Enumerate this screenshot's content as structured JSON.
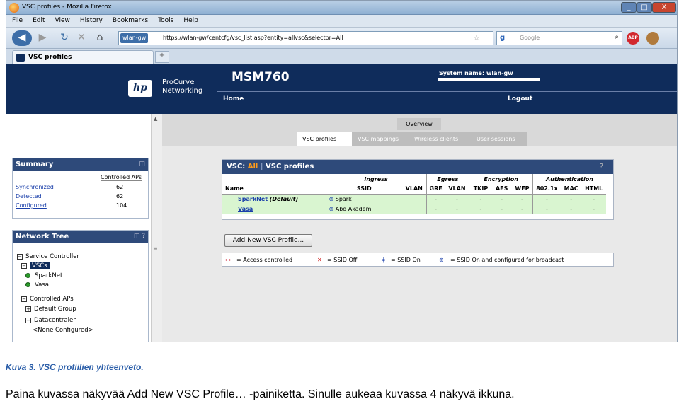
{
  "window": {
    "title": "VSC profiles - Mozilla Firefox",
    "min": "_",
    "max": "□",
    "close": "X"
  },
  "menu": [
    "File",
    "Edit",
    "View",
    "History",
    "Bookmarks",
    "Tools",
    "Help"
  ],
  "nav": {
    "site_label": "wlan-gw",
    "url": "https://wlan-gw/centcfg/vsc_list.asp?entity=allvsc&selector=All",
    "search_placeholder": "Google"
  },
  "tab": {
    "label": "VSC profiles",
    "new_tab": "+"
  },
  "header": {
    "brand_line1": "ProCurve",
    "brand_line2": "Networking",
    "product": "MSM760",
    "system_name_label": "System name: wlan-gw",
    "home": "Home",
    "logout": "Logout",
    "logo": "hp"
  },
  "subtabs": {
    "overview": "Overview",
    "items": [
      "VSC profiles",
      "VSC mappings",
      "Wireless clients",
      "User sessions"
    ]
  },
  "summary": {
    "title": "Summary",
    "col_header": "Controlled APs",
    "rows": [
      {
        "label": "Synchronized",
        "value": "62"
      },
      {
        "label": "Detected",
        "value": "62"
      },
      {
        "label": "Configured",
        "value": "104"
      }
    ]
  },
  "network_tree": {
    "title": "Network Tree",
    "service_controller": "Service Controller",
    "vscs": "VSCs",
    "vsc_items": [
      "SparkNet",
      "Vasa"
    ],
    "controlled_aps": "Controlled APs",
    "default_group": "Default Group",
    "datacentralen": "Datacentralen",
    "none_configured": "<None Configured>"
  },
  "vsc_panel": {
    "title_prefix": "VSC:",
    "title_all": "All",
    "title_sep": "|",
    "title_main": "VSC profiles",
    "help": "?",
    "groups": {
      "ingress": "Ingress",
      "egress": "Egress",
      "encryption": "Encryption",
      "authentication": "Authentication"
    },
    "columns": {
      "name": "Name",
      "ssid": "SSID",
      "vlan": "VLAN",
      "gre": "GRE",
      "evlan": "VLAN",
      "tkip": "TKIP",
      "aes": "AES",
      "wep": "WEP",
      "x": "802.1x",
      "mac": "MAC",
      "html": "HTML"
    },
    "rows": [
      {
        "name": "SparkNet",
        "suffix": "(Default)",
        "ssid": "Spark",
        "vlan": "",
        "gre": "-",
        "evlan": "-",
        "tkip": "-",
        "aes": "-",
        "wep": "-",
        "x": "-",
        "mac": "-",
        "html": "-"
      },
      {
        "name": "Vasa",
        "suffix": "",
        "ssid": "Abo Akademi",
        "vlan": "",
        "gre": "-",
        "evlan": "-",
        "tkip": "-",
        "aes": "-",
        "wep": "-",
        "x": "-",
        "mac": "-",
        "html": "-"
      }
    ]
  },
  "add_button": "Add New VSC Profile...",
  "legend": {
    "access": "= Access controlled",
    "off": "= SSID Off",
    "on": "= SSID On",
    "broadcast": "= SSID On and configured for broadcast"
  },
  "caption": {
    "figure": "Kuva 3. VSC profiilien yhteenveto.",
    "text": "Paina kuvassa näkyvää Add New VSC Profile… -painiketta. Sinulle aukeaa kuvassa 4 näkyvä ikkuna."
  }
}
